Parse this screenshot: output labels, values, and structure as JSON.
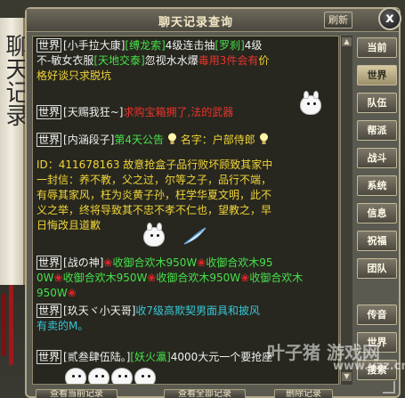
{
  "window": {
    "title": "聊天记录查询",
    "refresh_label": "刷新",
    "close_label": "x"
  },
  "left_scroll_text": "聊天记录",
  "tabs": [
    {
      "label": "当前",
      "active": false
    },
    {
      "label": "世界",
      "active": true
    },
    {
      "label": "队伍",
      "active": false
    },
    {
      "label": "帮派",
      "active": false
    },
    {
      "label": "战斗",
      "active": false
    },
    {
      "label": "系统",
      "active": false
    },
    {
      "label": "信息",
      "active": false
    },
    {
      "label": "祝福",
      "active": false
    },
    {
      "label": "团队",
      "active": false
    },
    {
      "label": "传音",
      "active": false
    },
    {
      "label": "世界",
      "active": false
    },
    {
      "label": "搜索",
      "active": false
    }
  ],
  "messages": {
    "m1": {
      "tag": "世界",
      "name1": "[小手拉大康]",
      "name2": "[缚龙索]",
      "text1": "4级连击抽",
      "name3": "[罗刹]",
      "text2": "4级",
      "line2a": "不-敏女衣服",
      "name4": "[天地交泰]",
      "line2b": "忽视水水爆",
      "line2c": "毒用3件会有",
      "line2d": "价",
      "line3": "格好谈只求脱坑"
    },
    "m2": {
      "tag": "世界",
      "name": "[天赐我狂~]",
      "text": "求购宝箱拥了,法的武器"
    },
    "m3": {
      "tag": "世界",
      "name": "[内涵段子]",
      "announce": "第4天公告",
      "text": "名字：户部侍郎"
    },
    "m4": {
      "id_line": "ID：411678163 故意抢盒子品行败坏顾致其家中",
      "line2": "一封信：养不教，父之过，尔等之子，品行不端，",
      "line3": "有辱其家风，枉为炎黄子孙，枉学华夏文明，此不",
      "line4": "义之举，终将导致其不忠不孝不仁也，望教之，早",
      "line5": "日悔改且道歉"
    },
    "m5": {
      "tag": "世界",
      "name": "[战の神]",
      "text1": "收御合欢木950W",
      "text2": "收御合欢木95",
      "line2a": "0W",
      "line2b": "收御合欢木950W",
      "line2c": "收御合欢木950W",
      "line2d": "收御合欢木950W"
    },
    "m6": {
      "tag": "世界",
      "name": "[玖天ヾ小天哥]",
      "text": "收7级高欺契男面具和披风",
      "line2": "有卖的M。"
    },
    "m7": {
      "tag": "世界",
      "name": "[贰叁肆伍陆。]",
      "name2": "[妖火瀛]",
      "text": "4000大元一个要抢座"
    }
  },
  "scroll": {
    "up": "▲",
    "down": "▼"
  },
  "bottom_buttons": [
    "查看当前记录",
    "查看全部记录",
    "删除记录"
  ],
  "watermark": {
    "logo": "叶子猪 游戏网",
    "domain": "www.yzz.cn"
  },
  "colors": {
    "green": "#47e04a",
    "red": "#e8342e",
    "yellow": "#f1d537",
    "cyan": "#37c6d5"
  }
}
